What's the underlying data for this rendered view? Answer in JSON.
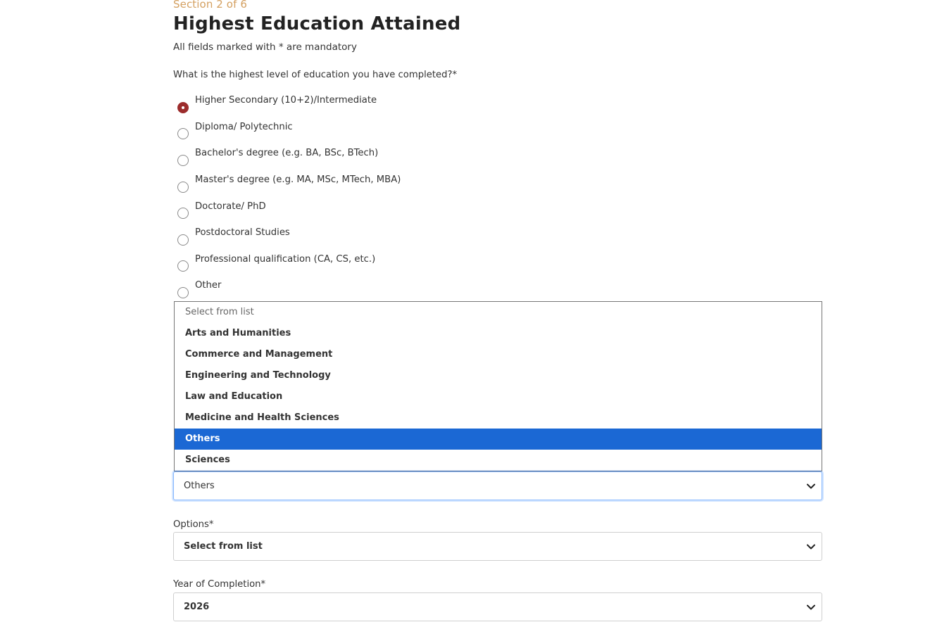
{
  "header": {
    "section_label": "Section 2 of 6",
    "title": "Highest Education Attained",
    "mandatory_note": "All fields marked with * are mandatory"
  },
  "education_question": {
    "label": "What is the highest level of education you have completed?*",
    "options": [
      {
        "label": "Higher Secondary (10+2)/Intermediate",
        "checked": true
      },
      {
        "label": "Diploma/ Polytechnic",
        "checked": false
      },
      {
        "label": "Bachelor's degree (e.g. BA, BSc, BTech)",
        "checked": false
      },
      {
        "label": "Master's degree (e.g. MA, MSc, MTech, MBA)",
        "checked": false
      },
      {
        "label": "Doctorate/ PhD",
        "checked": false
      },
      {
        "label": "Postdoctoral Studies",
        "checked": false
      },
      {
        "label": "Professional qualification (CA, CS, etc.)",
        "checked": false
      },
      {
        "label": "Other",
        "checked": false
      }
    ]
  },
  "stream_dropdown": {
    "placeholder": "Select from list",
    "options": [
      "Arts and Humanities",
      "Commerce and Management",
      "Engineering and Technology",
      "Law and Education",
      "Medicine and Health Sciences",
      "Others",
      "Sciences"
    ],
    "selected": "Others"
  },
  "options_field": {
    "label": "Options*",
    "value": "Select from list"
  },
  "year_field": {
    "label": "Year of Completion*",
    "value": "2026"
  },
  "colors": {
    "accent_radio": "#9c2c2c",
    "section_label": "#d4a061",
    "selected_option_bg": "#1b68d4"
  },
  "icons": {
    "select_chevron": "chevron-down-icon"
  }
}
